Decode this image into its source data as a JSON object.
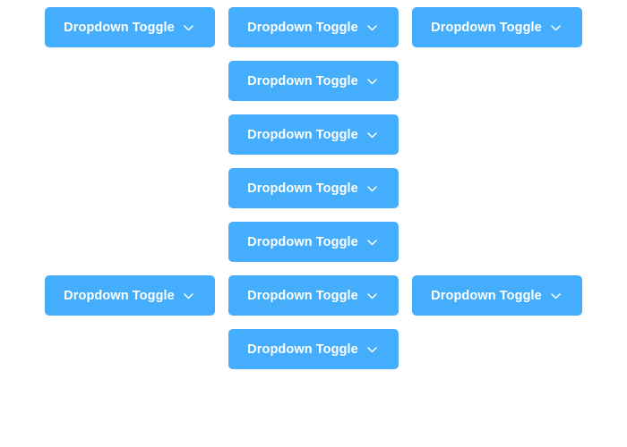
{
  "buttons": {
    "top_left": {
      "label": "Dropdown Toggle",
      "icon": "chevron-down-icon"
    },
    "top_center": {
      "label": "Dropdown Toggle",
      "icon": "chevron-down-icon"
    },
    "top_right": {
      "label": "Dropdown Toggle",
      "icon": "chevron-down-icon"
    },
    "center_2": {
      "label": "Dropdown Toggle",
      "icon": "chevron-down-icon"
    },
    "center_3": {
      "label": "Dropdown Toggle",
      "icon": "chevron-down-icon"
    },
    "center_4": {
      "label": "Dropdown Toggle",
      "icon": "chevron-down-icon"
    },
    "center_5": {
      "label": "Dropdown Toggle",
      "icon": "chevron-down-icon"
    },
    "bottom_left": {
      "label": "Dropdown Toggle",
      "icon": "chevron-down-icon"
    },
    "bottom_center": {
      "label": "Dropdown Toggle",
      "icon": "chevron-down-icon"
    },
    "bottom_right": {
      "label": "Dropdown Toggle",
      "icon": "chevron-down-icon"
    },
    "last_center": {
      "label": "Dropdown Toggle",
      "icon": "chevron-down-icon"
    }
  },
  "colors": {
    "button_bg": "#45aefc",
    "button_text": "#ffffff",
    "page_bg": "#ffffff"
  }
}
